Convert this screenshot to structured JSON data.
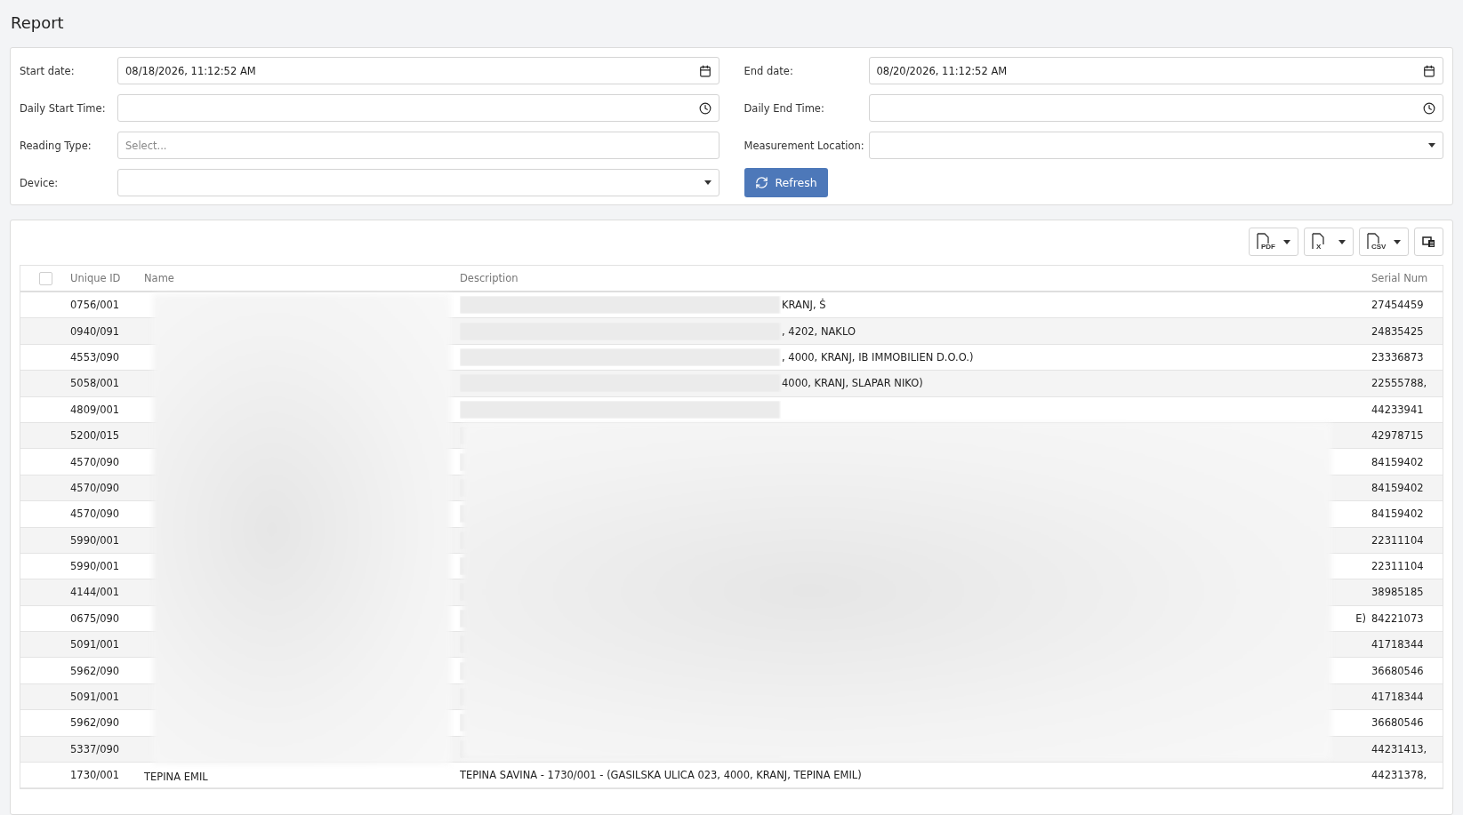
{
  "page": {
    "title": "Report"
  },
  "filters": {
    "left": [
      {
        "label": "Start date:",
        "kind": "date",
        "value": "08/18/2026, 11:12:52 AM"
      },
      {
        "label": "Daily Start Time:",
        "kind": "time"
      },
      {
        "label": "Reading Type:",
        "kind": "multi",
        "placeholder": "Select..."
      },
      {
        "label": "Device:",
        "kind": "select"
      }
    ],
    "right": [
      {
        "label": "End date:",
        "kind": "date",
        "value": "08/20/2026, 11:12:52 AM"
      },
      {
        "label": "Daily End Time:",
        "kind": "time"
      },
      {
        "label": "Measurement Location:",
        "kind": "select"
      }
    ],
    "refresh_button": "Refresh"
  },
  "export_buttons": [
    {
      "kind": "pdf",
      "label": "PDF"
    },
    {
      "kind": "excel",
      "label": "X"
    },
    {
      "kind": "csv",
      "label": "CSV"
    },
    {
      "kind": "columns"
    }
  ],
  "table": {
    "select_all_checked": false,
    "columns": [
      "Unique ID",
      "Name",
      "Description",
      "Serial Num"
    ],
    "rows": [
      {
        "id": "0756/001",
        "redacted": true,
        "description": "KRANJ, Š",
        "serial": "27454459"
      },
      {
        "id": "0940/091",
        "redacted": true,
        "description": ", 4202, NAKLO",
        "serial": "24835425"
      },
      {
        "id": "4553/090",
        "redacted": true,
        "description": ", 4000, KRANJ, IB IMMOBILIEN D.O.O.)",
        "serial": "23336873"
      },
      {
        "id": "5058/001",
        "redacted": true,
        "description": "4000, KRANJ, SLAPAR NIKO)",
        "serial": "22555788,"
      },
      {
        "id": "4809/001",
        "redacted": true,
        "serial": "44233941"
      },
      {
        "id": "5200/015",
        "redacted": true,
        "serial": "42978715"
      },
      {
        "id": "4570/090",
        "redacted": true,
        "serial": "84159402"
      },
      {
        "id": "4570/090",
        "redacted": true,
        "serial": "84159402"
      },
      {
        "id": "4570/090",
        "redacted": true,
        "serial": "84159402"
      },
      {
        "id": "5990/001",
        "redacted": true,
        "serial": "22311104"
      },
      {
        "id": "5990/001",
        "redacted": true,
        "serial": "22311104"
      },
      {
        "id": "4144/001",
        "redacted": true,
        "serial": "38985185"
      },
      {
        "id": "0675/090",
        "redacted": true,
        "description_tail": "E)",
        "serial": "84221073"
      },
      {
        "id": "5091/001",
        "redacted": true,
        "serial": "41718344"
      },
      {
        "id": "5962/090",
        "redacted": true,
        "serial": "36680546"
      },
      {
        "id": "5091/001",
        "redacted": true,
        "serial": "41718344"
      },
      {
        "id": "5962/090",
        "redacted": true,
        "serial": "36680546"
      },
      {
        "id": "5337/090",
        "redacted": true,
        "serial": "44231413,"
      },
      {
        "id": "1730/001",
        "redacted": false,
        "name": "TEPINA EMIL",
        "description": "TEPINA SAVINA - 1730/001 - (GASILSKA ULICA 023, 4000, KRANJ, TEPINA EMIL)",
        "serial": "44231378,"
      }
    ]
  }
}
